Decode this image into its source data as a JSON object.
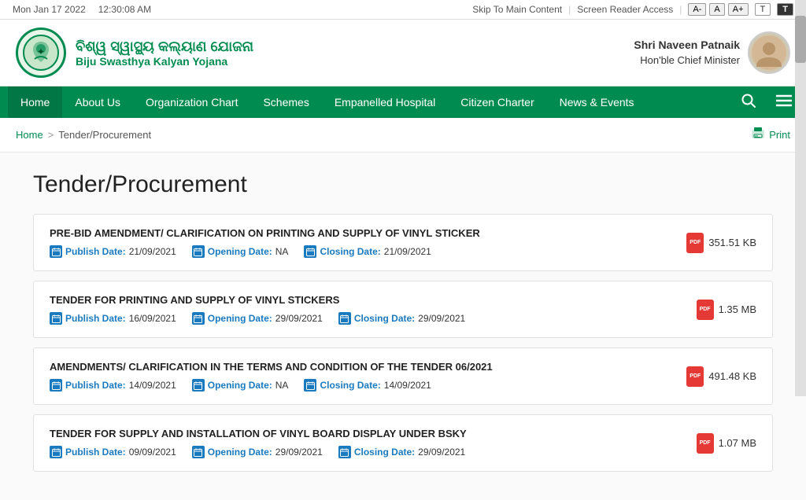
{
  "topbar": {
    "datetime": "Mon Jan 17 2022",
    "time": "12:30:08 AM",
    "skip_link": "Skip To Main Content",
    "screen_reader": "Screen Reader Access",
    "font_small": "A-",
    "font_normal": "A",
    "font_large": "A+",
    "theme_t": "T",
    "theme_t2": "T"
  },
  "header": {
    "logo_odia": "ବିଶ୍ୱ ସ୍ୱାସ୍ଥ୍ୟ କଲ୍ୟାଣ ଯୋଜନା",
    "logo_english": "Biju Swasthya Kalyan Yojana",
    "minister_label1": "Shri Naveen Patnaik",
    "minister_label2": "Hon'ble Chief Minister"
  },
  "nav": {
    "items": [
      {
        "label": "Home",
        "active": true
      },
      {
        "label": "About Us",
        "active": false
      },
      {
        "label": "Organization Chart",
        "active": false
      },
      {
        "label": "Schemes",
        "active": false
      },
      {
        "label": "Empanelled Hospital",
        "active": false
      },
      {
        "label": "Citizen Charter",
        "active": false
      },
      {
        "label": "News & Events",
        "active": false
      }
    ]
  },
  "breadcrumb": {
    "home": "Home",
    "separator": ">",
    "current": "Tender/Procurement",
    "print_label": "Print"
  },
  "page": {
    "title": "Tender/Procurement"
  },
  "tenders": [
    {
      "title": "PRE-BID AMENDMENT/ CLARIFICATION ON PRINTING AND SUPPLY OF VINYL STICKER",
      "publish_label": "Publish Date:",
      "publish_date": "21/09/2021",
      "opening_label": "Opening Date:",
      "opening_date": "NA",
      "closing_label": "Closing Date:",
      "closing_date": "21/09/2021",
      "file_size": "351.51 KB"
    },
    {
      "title": "TENDER FOR PRINTING AND SUPPLY OF VINYL STICKERS",
      "publish_label": "Publish Date:",
      "publish_date": "16/09/2021",
      "opening_label": "Opening Date:",
      "opening_date": "29/09/2021",
      "closing_label": "Closing Date:",
      "closing_date": "29/09/2021",
      "file_size": "1.35 MB"
    },
    {
      "title": "AMENDMENTS/ CLARIFICATION IN THE TERMS AND CONDITION OF THE TENDER 06/2021",
      "publish_label": "Publish Date:",
      "publish_date": "14/09/2021",
      "opening_label": "Opening Date:",
      "opening_date": "NA",
      "closing_label": "Closing Date:",
      "closing_date": "14/09/2021",
      "file_size": "491.48 KB"
    },
    {
      "title": "TENDER FOR SUPPLY AND INSTALLATION OF VINYL BOARD DISPLAY UNDER BSKY",
      "publish_label": "Publish Date:",
      "publish_date": "09/09/2021",
      "opening_label": "Opening Date:",
      "opening_date": "29/09/2021",
      "closing_label": "Closing Date:",
      "closing_date": "29/09/2021",
      "file_size": "1.07 MB"
    }
  ]
}
